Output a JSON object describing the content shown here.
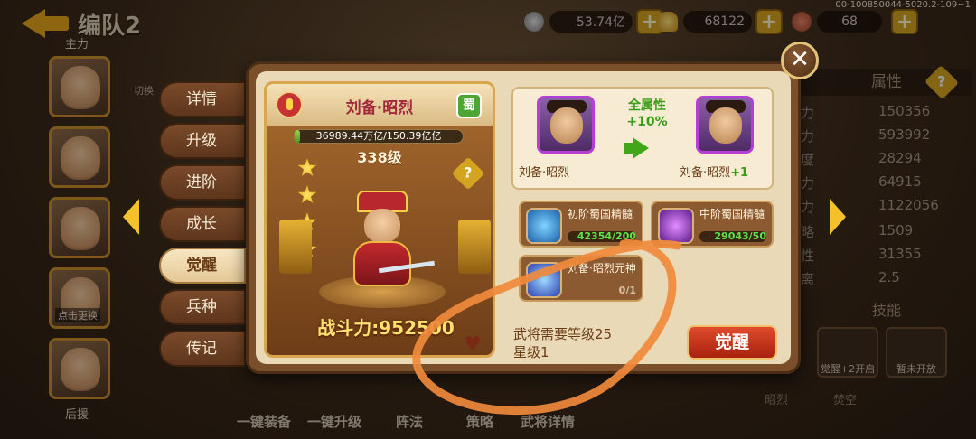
{
  "header": {
    "title": "编队2",
    "debug_code": "00-100850044-5020.2-109~1"
  },
  "currencies": [
    {
      "icon": "coin-icon",
      "value": "53.74亿"
    },
    {
      "icon": "gold-ingot-icon",
      "value": "68122"
    },
    {
      "icon": "meat-stamina-icon",
      "value": "68"
    }
  ],
  "left_column": {
    "top_label": "主力",
    "bottom_label": "后援",
    "slots": [
      {
        "tag": ""
      },
      {
        "tag": ""
      },
      {
        "tag": ""
      },
      {
        "tag": "点击更换"
      },
      {
        "tag": ""
      }
    ],
    "switch_label": "切换"
  },
  "tabs": [
    "详情",
    "升级",
    "进阶",
    "成长",
    "觉醒",
    "兵种",
    "传记"
  ],
  "active_tab": 4,
  "card": {
    "name": "刘备·昭烈",
    "green_badge": "蜀",
    "hp_text": "36989.44万亿/150.39亿亿",
    "level": "338级",
    "stars": 4,
    "power": "战斗力:952500"
  },
  "awaken": {
    "full_attr_label": "全属性",
    "full_attr_value": "+10%",
    "from_name": "刘备·昭烈",
    "to_name": "刘备·昭烈",
    "to_plus": "+1",
    "materials": [
      {
        "name": "初阶蜀国精髓",
        "count": "42354/200",
        "color": "#5fe34b"
      },
      {
        "name": "中阶蜀国精髓",
        "count": "29043/50",
        "color": "#5fe34b"
      },
      {
        "name": "刘备·昭烈元神",
        "count": "0/1",
        "color": "#d7c6a8"
      }
    ],
    "requirement_line1": "武将需要等级25",
    "requirement_line2": "星级1",
    "button_label": "觉醒"
  },
  "attributes": {
    "header": "属性",
    "rows": [
      {
        "key": "力",
        "value": "150356"
      },
      {
        "key": "力",
        "value": "593992"
      },
      {
        "key": "度",
        "value": "28294"
      },
      {
        "key": "力",
        "value": "64915"
      },
      {
        "key": "力",
        "value": "1122056"
      },
      {
        "key": "略",
        "value": "1509"
      },
      {
        "key": "性",
        "value": "31355"
      },
      {
        "key": "离",
        "value": "2.5"
      }
    ],
    "skills_title": "技能",
    "skills": [
      {
        "label": "觉醒+2开启"
      },
      {
        "label": "暂未开放"
      }
    ],
    "skill_names": [
      "昭烈",
      "焚空"
    ]
  },
  "bottom_bar": [
    "一键装备",
    "一键升级",
    "阵法",
    "策略",
    "武将详情"
  ],
  "colors": {
    "accent_gold": "#d4a320",
    "annotation": "#f08a3c",
    "active_tab": "#f7e6c2"
  }
}
